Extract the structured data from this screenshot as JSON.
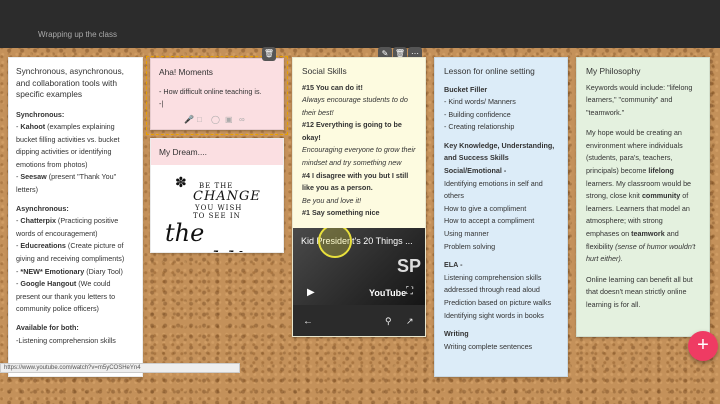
{
  "header": {
    "title": "Wrapping up the class"
  },
  "status_url": "https://www.youtube.com/watch?v=m5yCOSHeYn4",
  "card1": {
    "title_lines": [
      "Synchronous, asynchronous,",
      "and collaboration tools with",
      "specific examples"
    ],
    "sync_heading": "Synchronous:",
    "sync_items": [
      [
        "- ",
        "Kahoot",
        " (examples explaining"
      ],
      [
        "",
        "",
        "bucket filling activities vs. bucket"
      ],
      [
        "",
        "",
        "dipping activities or identifying"
      ],
      [
        "",
        "",
        "emotions from photos)"
      ],
      [
        "- ",
        "Seesaw",
        " (present \"Thank You\""
      ],
      [
        "",
        "",
        "letters)"
      ]
    ],
    "async_heading": "Asynchronous:",
    "async_items": [
      [
        "- ",
        "Chatterpix",
        " (Practicing positive"
      ],
      [
        "",
        "",
        "words of encouragement)"
      ],
      [
        "- ",
        "Educreations",
        " (Create picture of"
      ],
      [
        "",
        "",
        "giving and receiving compliments)"
      ],
      [
        "- ",
        "*NEW* Emotionary",
        " (Diary Tool)"
      ],
      [
        "- ",
        "Google Hangout",
        " (We could"
      ],
      [
        "",
        "",
        "present our thank you letters to"
      ],
      [
        "",
        "",
        "community police officers)"
      ]
    ],
    "both_heading": "Available for both:",
    "both_items": [
      "-Listening comprehension skills"
    ]
  },
  "card2": {
    "title": "Aha! Moments",
    "body": "- How difficult online teaching is.",
    "cursor": "-|"
  },
  "card3": {
    "title": "My Dream....",
    "quote": {
      "l1": "BE THE",
      "l2": "CHANGE",
      "l3": "YOU WISH",
      "l4": "TO SEE IN",
      "l5": "the world!"
    }
  },
  "card4": {
    "title": "Social Skills",
    "lines": [
      {
        "t": "#15 You can do it!",
        "s": "b"
      },
      {
        "t": "Always encourage students to do",
        "s": "i"
      },
      {
        "t": "their best!",
        "s": "i"
      },
      {
        "t": "#12 Everything is going to be",
        "s": "b"
      },
      {
        "t": "okay!",
        "s": "b"
      },
      {
        "t": "Encouraging everyone to grow their",
        "s": "i"
      },
      {
        "t": "mindset and try something new",
        "s": "i"
      },
      {
        "t": "#4 I disagree with you but I still",
        "s": "b"
      },
      {
        "t": "like you as a person.",
        "s": "b"
      },
      {
        "t": "Be you and love it!",
        "s": "i"
      },
      {
        "t": "#1 Say something nice",
        "s": "b"
      }
    ],
    "video": {
      "title": "Kid President's 20 Things ...",
      "brand": "YouTube",
      "logo": "SP"
    }
  },
  "card5": {
    "title": "Lesson for online setting",
    "lines": [
      {
        "t": "Bucket Filler",
        "s": "b"
      },
      {
        "t": "- Kind words/ Manners",
        "s": ""
      },
      {
        "t": "- Building confidence",
        "s": ""
      },
      {
        "t": "- Creating relationship",
        "s": ""
      },
      {
        "t": "",
        "s": ""
      },
      {
        "t": "Key Knowledge, Understanding,",
        "s": "b"
      },
      {
        "t": "and Success Skills",
        "s": "b"
      },
      {
        "t": "Social/Emotional -",
        "s": "b"
      },
      {
        "t": "Identifying emotions in self and",
        "s": ""
      },
      {
        "t": "others",
        "s": ""
      },
      {
        "t": "How to give a compliment",
        "s": ""
      },
      {
        "t": "How to accept a compliment",
        "s": ""
      },
      {
        "t": "Using manner",
        "s": ""
      },
      {
        "t": "Problem solving",
        "s": ""
      },
      {
        "t": "",
        "s": ""
      },
      {
        "t": "ELA -",
        "s": "b"
      },
      {
        "t": "Listening comprehension skills",
        "s": ""
      },
      {
        "t": "addressed through read aloud",
        "s": ""
      },
      {
        "t": "Prediction based on picture walks",
        "s": ""
      },
      {
        "t": "Identifying sight words in books",
        "s": ""
      },
      {
        "t": "",
        "s": ""
      },
      {
        "t": "Writing",
        "s": "b"
      },
      {
        "t": "Writing complete sentences",
        "s": ""
      }
    ]
  },
  "card6": {
    "title": "My Philosophy",
    "p1": [
      "Keywords would include: \"lifelong",
      "learners,\" \"community\" and",
      "\"teamwork.\""
    ],
    "p2": [
      [
        [
          "My hope would be creating an",
          ""
        ]
      ],
      [
        [
          "environment where individuals",
          ""
        ]
      ],
      [
        [
          "(students, para's, teachers,",
          ""
        ]
      ],
      [
        [
          "principals) become ",
          ""
        ],
        [
          "lifelong",
          "b"
        ]
      ],
      [
        [
          "learners",
          ""
        ],
        [
          ". My classroom would be",
          ""
        ]
      ],
      [
        [
          "strong, close knit  ",
          ""
        ],
        [
          "community",
          "b"
        ],
        [
          " of",
          ""
        ]
      ],
      [
        [
          "learners. Learners that model an",
          ""
        ]
      ],
      [
        [
          "atmosphere; with strong",
          ""
        ]
      ],
      [
        [
          "emphases on ",
          ""
        ],
        [
          "teamwork",
          "b"
        ],
        [
          " and",
          ""
        ]
      ],
      [
        [
          "flexibility ",
          ""
        ],
        [
          "(sense of humor wouldn't",
          "i"
        ]
      ],
      [
        [
          "hurt either).",
          "i"
        ]
      ]
    ],
    "p3": [
      "Online learning can benefit all but",
      "that doesn't mean strictly online",
      "learning is for all."
    ]
  },
  "fab_label": "+",
  "colors": {
    "white": "#ffffff",
    "pink": "#fbdfe2",
    "yellow": "#fdfbe0",
    "blue": "#dcecf8",
    "green": "#e4f1df",
    "fab": "#ef3b63",
    "cork": "#c4915a"
  }
}
